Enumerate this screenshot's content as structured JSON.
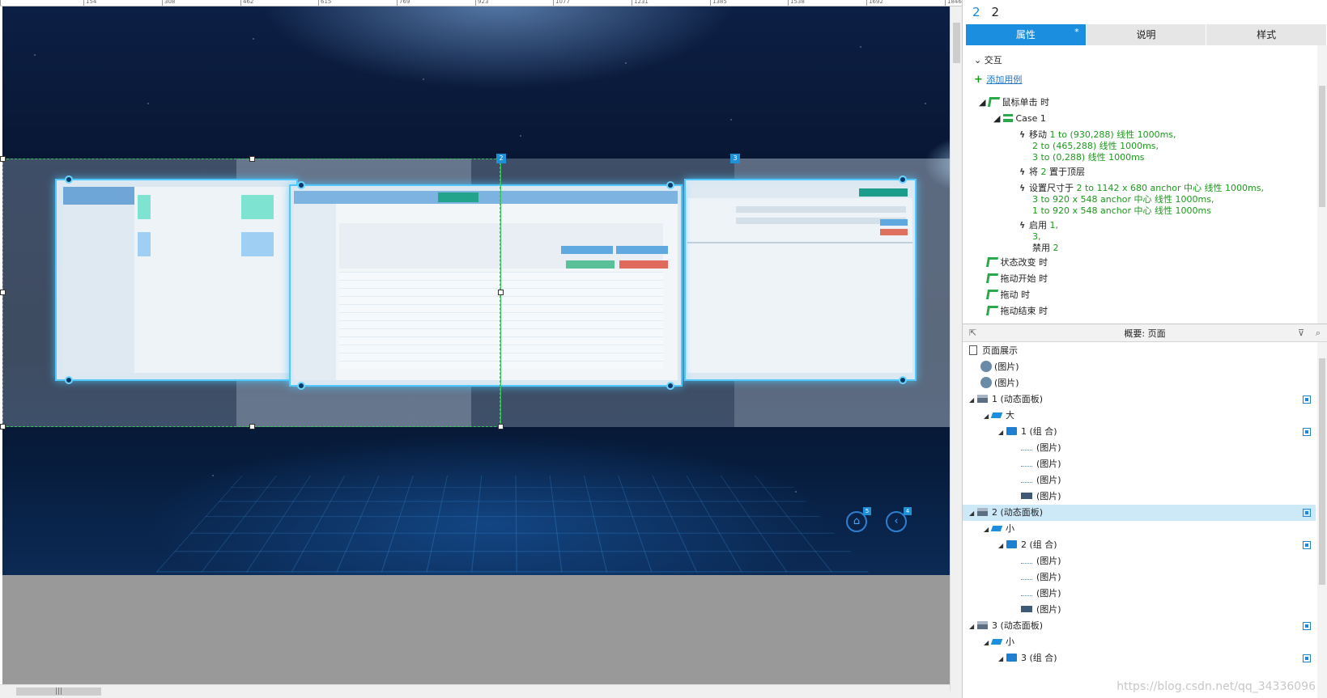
{
  "ruler": {
    "labels": [
      "154",
      "308",
      "462",
      "615",
      "769",
      "923",
      "1077",
      "1231",
      "1385",
      "1538",
      "1692",
      "1846"
    ]
  },
  "canvas": {
    "markers": [
      "2",
      "3"
    ],
    "nav_markers": [
      "5",
      "4"
    ]
  },
  "inspector": {
    "title_id": "2",
    "title_name": "2",
    "tabs": [
      {
        "label": "属性",
        "mark": "*"
      },
      {
        "label": "说明"
      },
      {
        "label": "样式"
      }
    ]
  },
  "props": {
    "section": "交互",
    "add_case": "添加用例",
    "on_click": "鼠标单击 时",
    "case1": "Case 1",
    "move_prefix": "移动",
    "move_lines": [
      "1 to (930,288) 线性 1000ms,",
      "2 to (465,288) 线性 1000ms,",
      "3 to (0,288) 线性 1000ms"
    ],
    "bring_front_prefix": "将",
    "bring_front_target": "2",
    "bring_front_suffix": "置于顶层",
    "resize_prefix": "设置尺寸于",
    "resize_lines": [
      "2 to 1142 x 680 anchor 中心 线性 1000ms,",
      "3 to 920 x 548 anchor 中心 线性 1000ms,",
      "1 to 920 x 548 anchor 中心 线性 1000ms"
    ],
    "enable_prefix": "启用",
    "enable_lines": [
      "1,",
      "3,"
    ],
    "disable_prefix": "禁用",
    "disable_target": "2",
    "events": [
      "状态改变 时",
      "拖动开始 时",
      "拖动 时",
      "拖动结束 时"
    ]
  },
  "outline": {
    "title": "概要: 页面",
    "rows": [
      {
        "label": "页面展示"
      },
      {
        "label": "(图片)"
      },
      {
        "label": "(图片)"
      },
      {
        "label": "1 (动态面板)"
      },
      {
        "label": "大"
      },
      {
        "label": "1 (组 合)"
      },
      {
        "label": "(图片)"
      },
      {
        "label": "(图片)"
      },
      {
        "label": "(图片)"
      },
      {
        "label": "(图片)"
      },
      {
        "label": "2 (动态面板)"
      },
      {
        "label": "小"
      },
      {
        "label": "2 (组 合)"
      },
      {
        "label": "(图片)"
      },
      {
        "label": "(图片)"
      },
      {
        "label": "(图片)"
      },
      {
        "label": "(图片)"
      },
      {
        "label": "3 (动态面板)"
      },
      {
        "label": "小"
      },
      {
        "label": "3 (组 合)"
      }
    ]
  },
  "watermark": "https://blog.csdn.net/qq_34336096"
}
